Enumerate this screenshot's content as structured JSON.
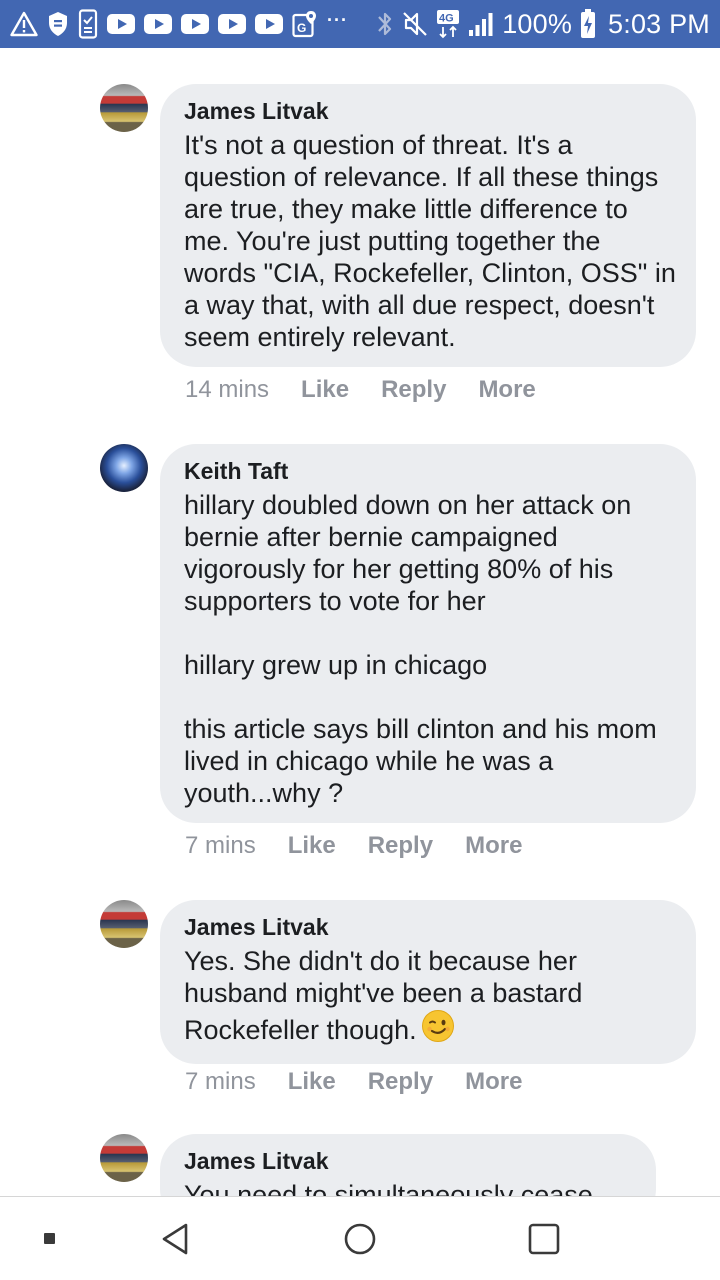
{
  "status_bar": {
    "left_icons": [
      "alert-triangle-icon",
      "shield-icon",
      "phone-check-icon",
      "youtube-icon",
      "youtube-icon",
      "youtube-icon",
      "youtube-icon",
      "youtube-icon",
      "google-maps-icon"
    ],
    "overflow": "···",
    "battery_percent": "100%",
    "time": "5:03 PM",
    "network": "4G",
    "background_color": "#4267b2"
  },
  "comments": [
    {
      "author": "James Litvak",
      "text": "It's not a question of threat. It's a question of relevance. If all these things are true, they make little difference to me. You're just putting together the words \"CIA, Rockefeller, Clinton, OSS\" in a way that, with all due respect, doesn't seem entirely relevant.",
      "time": "14 mins",
      "like": "Like",
      "reply": "Reply",
      "more": "More"
    },
    {
      "author": "Keith Taft",
      "text": "hillary doubled down on her attack on bernie after bernie campaigned vigorously for her getting 80% of his supporters to vote for her\n\nhillary grew up in chicago\n\nthis article says bill clinton and his mom lived in chicago while he was a youth...why ?",
      "time": "7 mins",
      "like": "Like",
      "reply": "Reply",
      "more": "More"
    },
    {
      "author": "James Litvak",
      "text": "Yes. She didn't do it because her husband might've been a bastard Rockefeller though.",
      "emoji": "winking-face",
      "time": "7 mins",
      "like": "Like",
      "reply": "Reply",
      "more": "More"
    },
    {
      "author": "James Litvak",
      "text": "You need to simultaneously cease"
    }
  ],
  "nav_bar": {
    "buttons": [
      "recent-indicator-icon",
      "back-icon",
      "home-icon",
      "overview-icon"
    ]
  }
}
